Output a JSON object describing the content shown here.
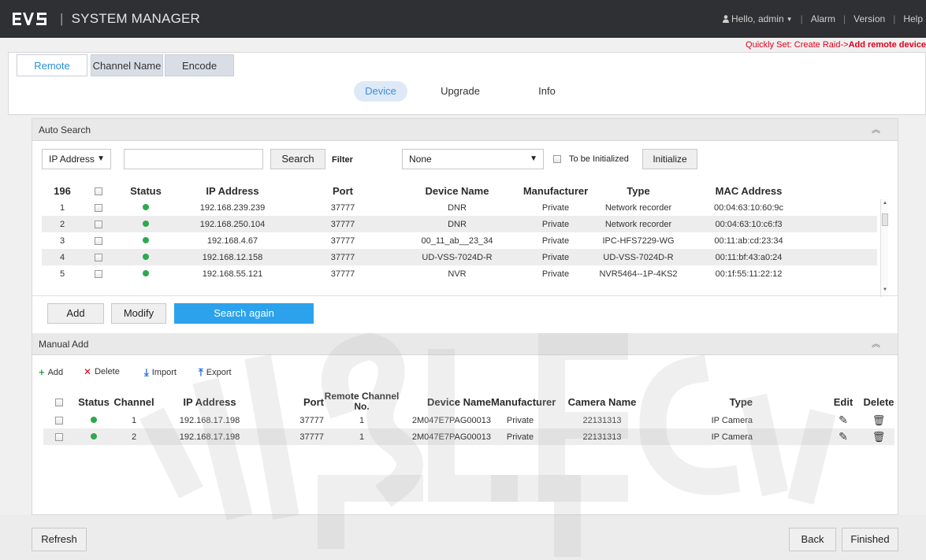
{
  "header": {
    "logo_text": "EVS",
    "app_title": "SYSTEM MANAGER",
    "user_greeting": "Hello, admin",
    "links": [
      "Alarm",
      "Version",
      "Help"
    ]
  },
  "quick_set": {
    "prefix": "Quickly Set: Create Raid->",
    "highlight": "Add remote device"
  },
  "tabs": {
    "remote": "Remote",
    "channel_name": "Channel Name",
    "encode": "Encode"
  },
  "subtabs": {
    "device": "Device",
    "upgrade": "Upgrade",
    "info": "Info"
  },
  "auto_search": {
    "title": "Auto Search",
    "search_by": "IP Address",
    "search_value": "",
    "search_button": "Search",
    "filter_label": "Filter",
    "filter_value": "None",
    "to_init_label": "To be Initialized",
    "initialize_button": "Initialize",
    "columns": {
      "count": "196",
      "status": "Status",
      "ip": "IP Address",
      "port": "Port",
      "device_name": "Device Name",
      "manufacturer": "Manufacturer",
      "type": "Type",
      "mac": "MAC Address"
    },
    "rows": [
      {
        "n": "1",
        "ip": "192.168.239.239",
        "port": "37777",
        "name": "DNR",
        "mfr": "Private",
        "type": "Network recorder",
        "mac": "00:04:63:10:60:9c"
      },
      {
        "n": "2",
        "ip": "192.168.250.104",
        "port": "37777",
        "name": "DNR",
        "mfr": "Private",
        "type": "Network recorder",
        "mac": "00:04:63:10:c6:f3"
      },
      {
        "n": "3",
        "ip": "192.168.4.67",
        "port": "37777",
        "name": "00_11_ab__23_34",
        "mfr": "Private",
        "type": "IPC-HFS7229-WG",
        "mac": "00:11:ab:cd:23:34"
      },
      {
        "n": "4",
        "ip": "192.168.12.158",
        "port": "37777",
        "name": "UD-VSS-7024D-R",
        "mfr": "Private",
        "type": "UD-VSS-7024D-R",
        "mac": "00:11:bf:43:a0:24"
      },
      {
        "n": "5",
        "ip": "192.168.55.121",
        "port": "37777",
        "name": "NVR",
        "mfr": "Private",
        "type": "NVR5464--1P-4KS2",
        "mac": "00:1f:55:11:22:12"
      }
    ],
    "add_button": "Add",
    "modify_button": "Modify",
    "search_again_button": "Search again"
  },
  "manual_add": {
    "title": "Manual Add",
    "toolbar": {
      "add": "Add",
      "delete": "Delete",
      "import": "Import",
      "export": "Export"
    },
    "columns": {
      "status": "Status",
      "channel": "Channel",
      "ip": "IP Address",
      "port": "Port",
      "remote_channel": "Remote Channel No.",
      "device_name": "Device Name",
      "manufacturer": "Manufacturer",
      "camera_name": "Camera Name",
      "type": "Type",
      "edit": "Edit",
      "delete": "Delete"
    },
    "rows": [
      {
        "channel": "1",
        "ip": "192.168.17.198",
        "port": "37777",
        "remote": "1",
        "name": "2M047E7PAG00013",
        "mfr": "Private",
        "camera": "22131313",
        "type": "IP Camera"
      },
      {
        "channel": "2",
        "ip": "192.168.17.198",
        "port": "37777",
        "remote": "1",
        "name": "2M047E7PAG00013",
        "mfr": "Private",
        "camera": "22131313",
        "type": "IP Camera"
      }
    ]
  },
  "footer": {
    "refresh": "Refresh",
    "back": "Back",
    "finished": "Finished"
  },
  "colors": {
    "topbar": "#2e3033",
    "accent": "#2ca2ec",
    "alert": "#e0001a",
    "status_online": "#2fa84f"
  },
  "icons": [
    "user-icon",
    "caret-down-icon",
    "collapse-up-icon",
    "dropdown-arrow-icon",
    "plus-icon",
    "x-icon",
    "import-icon",
    "export-icon",
    "pencil-icon",
    "trash-icon",
    "status-dot-icon"
  ]
}
